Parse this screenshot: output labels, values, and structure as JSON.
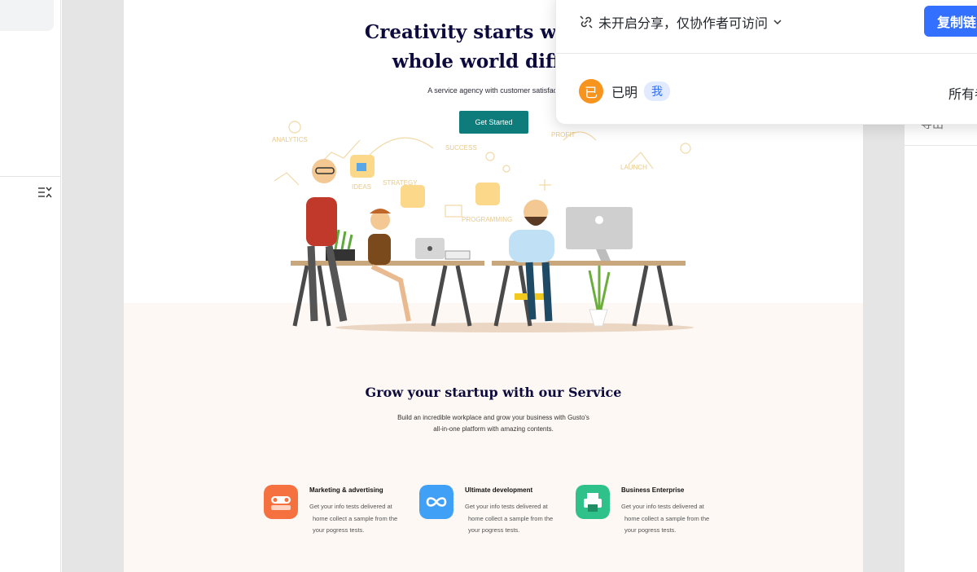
{
  "hero": {
    "title_line1": "Creativity starts with vie",
    "title_line2": "whole world differe",
    "subtitle": "A service agency with customer satisfact",
    "cta": "Get Started"
  },
  "illustration": {
    "labels": [
      "ANALYTICS",
      "SUCCESS",
      "PROFIT",
      "LAUNCH",
      "PROGRAMMING",
      "STRATEGY",
      "IDEAS"
    ]
  },
  "services": {
    "title": "Grow your startup with our Service",
    "subtitle_line1": "Build an incredible workplace and grow your business with Gusto's",
    "subtitle_line2": "all-in-one platform with amazing contents.",
    "items": [
      {
        "title": "Marketing & advertising",
        "desc1": "Get your info tests delivered at",
        "desc2": "home collect a sample from the",
        "desc3": "your pogress tests.",
        "color": "#f5713f",
        "icon": "toggle-icon"
      },
      {
        "title": "Ultimate development",
        "desc1": "Get your info tests delivered at",
        "desc2": "home collect a sample from the",
        "desc3": "your pogress tests.",
        "color": "#3fa0f5",
        "icon": "infinity-icon"
      },
      {
        "title": "Business Enterprise",
        "desc1": "Get your info tests delivered at",
        "desc2": "home collect a sample from the",
        "desc3": "your pogress tests.",
        "color": "#2ec28a",
        "icon": "printer-icon"
      }
    ]
  },
  "share_popover": {
    "status": "未开启分享，仅协作者可访问",
    "copy_button": "复制链",
    "member_initial": "已",
    "member_name": "已明",
    "me_badge": "我",
    "permission": "所有者"
  },
  "right_panel": {
    "text": "导出"
  },
  "colors": {
    "primary_blue": "#3370ff",
    "cta_teal": "#0e7c7b",
    "hero_navy": "#0d0b3e",
    "avatar_orange": "#f7941d"
  }
}
